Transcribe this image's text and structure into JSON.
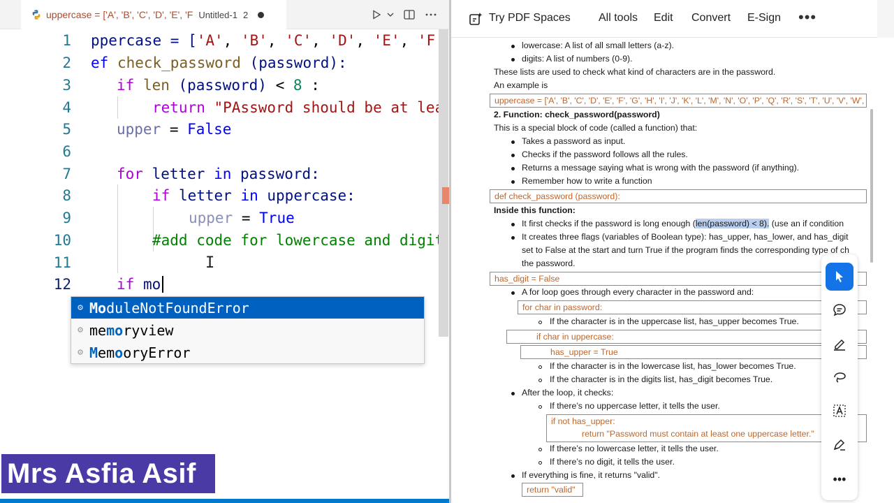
{
  "editor": {
    "tab": {
      "label": "uppercase = ['A', 'B', 'C', 'D', 'E', 'F",
      "file": "Untitled-1",
      "problems": "2"
    },
    "line_numbers": [
      "1",
      "2",
      "3",
      "4",
      "5",
      "6",
      "7",
      "8",
      "9",
      "10",
      "11",
      "12"
    ],
    "code": {
      "l1": {
        "a": "ppercase = [",
        "b": "'A'",
        "c": ", ",
        "d": "'B'",
        "e": ", ",
        "f": "'C'",
        "g": ", ",
        "h": "'D'",
        "i": ", ",
        "j": "'E'",
        "k": ", ",
        "l": "'F'"
      },
      "l2": {
        "a": "ef",
        "b": " check_password ",
        "c": "(password):"
      },
      "l3": {
        "a": "if",
        "b": " len ",
        "c": "(password)",
        "d": " < ",
        "e": "8",
        "f": " :"
      },
      "l4": {
        "a": "return",
        "b": " \"PAssword should be at lea"
      },
      "l5": {
        "a": "upper",
        "b": " = ",
        "c": "False"
      },
      "l7": {
        "a": "for",
        "b": " letter ",
        "c": "in",
        "d": " password:"
      },
      "l8": {
        "a": "if",
        "b": " letter ",
        "c": "in",
        "d": " uppercase:"
      },
      "l9": {
        "a": "upper",
        "b": " = ",
        "c": "True"
      },
      "l10": {
        "a": "#add code for lowercase and digit"
      },
      "l12": {
        "a": "if",
        "b": " mo"
      }
    },
    "suggestions": [
      {
        "match": "Mo",
        "rest": "duleNotFoundError"
      },
      {
        "match": "mo",
        "rest": "ryview",
        "pre": "me"
      },
      {
        "pre": "M",
        "match": "e",
        "mid": "m",
        "rest": "oryError"
      }
    ],
    "suggestion_items": [
      "ModuleNotFoundError",
      "memoryview",
      "MemoryError"
    ]
  },
  "presenter": {
    "name": "Mrs Asfia Asif"
  },
  "pdf_toolbar": {
    "spaces": "Try PDF Spaces",
    "all_tools": "All tools",
    "edit": "Edit",
    "convert": "Convert",
    "esign": "E-Sign",
    "more": "•••"
  },
  "pdf": {
    "b_lowercase": "lowercase: A list of all small letters (a-z).",
    "b_digits": "digits: A list of numbers (0-9).",
    "p_lists": "These lists are used to check what kind of characters are in the password.",
    "p_example": "An example is",
    "code_upper": "uppercase = ['A', 'B', 'C', 'D', 'E', 'F', 'G', 'H', 'I', 'J', 'K', 'L', 'M', 'N', 'O', 'P', 'Q', 'R', 'S', 'T', 'U', 'V', 'W', 'X',",
    "h_function": "2. Function: check_password(password)",
    "p_special": "This is a special block of code (called a function) that:",
    "b_takes": "Takes a password as input.",
    "b_checks": "Checks if the password follows all the rules.",
    "b_returns": "Returns a message saying what is wrong with the password (if anything).",
    "b_remember": "Remember how to write a function",
    "code_def": "def check_password (password):",
    "h_inside": "Inside this function:",
    "b_first_a": "It first checks if the password is long enough (",
    "b_first_hl": "len(password) < 8).",
    "b_first_b": " (use an if condition",
    "b_flags1": "It creates three flags (variables of Boolean type): has_upper, has_lower, and has_digit",
    "b_flags2": "set to False at the start and turn True if the program finds the corresponding type of ch",
    "b_flags3": "the password.",
    "code_hasdigit": "has_digit = False",
    "b_loop": "A for loop goes through every character in the password and:",
    "code_for": "for char in password:",
    "s_upper": "If the character is in the uppercase list, has_upper becomes True.",
    "code_ifchar": "if char in uppercase:",
    "code_hasupper": "has_upper = True",
    "s_lower": "If the character is in the lowercase list, has_lower becomes True.",
    "s_digit": "If the character is in the digits list, has_digit becomes True.",
    "b_after": "After the loop, it checks:",
    "s_noupper": "If there’s no uppercase letter, it tells the user.",
    "code_ifnot": "if not has_upper:",
    "code_return_msg": "return \"Password must contain at least one uppercase letter.\"",
    "s_nolower": "If there’s no lowercase letter, it tells the user.",
    "s_nodigit": "If there’s no digit, it tells the user.",
    "b_fine": "If everything is fine, it returns \"valid\".",
    "code_valid": "return \"valid\""
  },
  "colors": {
    "accent": "#1473e6",
    "suggest_selected": "#0060c0",
    "status_bar": "#007acc",
    "name_badge": "#4a3aa6",
    "pdf_code": "#c0652a"
  },
  "icons": [
    "python-file-icon",
    "run-icon",
    "chevron-down-icon",
    "split-editor-icon",
    "more-actions-icon",
    "pdf-spaces-icon",
    "select-cursor-icon",
    "comment-icon",
    "highlight-pen-icon",
    "draw-lasso-icon",
    "text-select-icon",
    "sign-pen-icon",
    "more-tools-icon"
  ]
}
